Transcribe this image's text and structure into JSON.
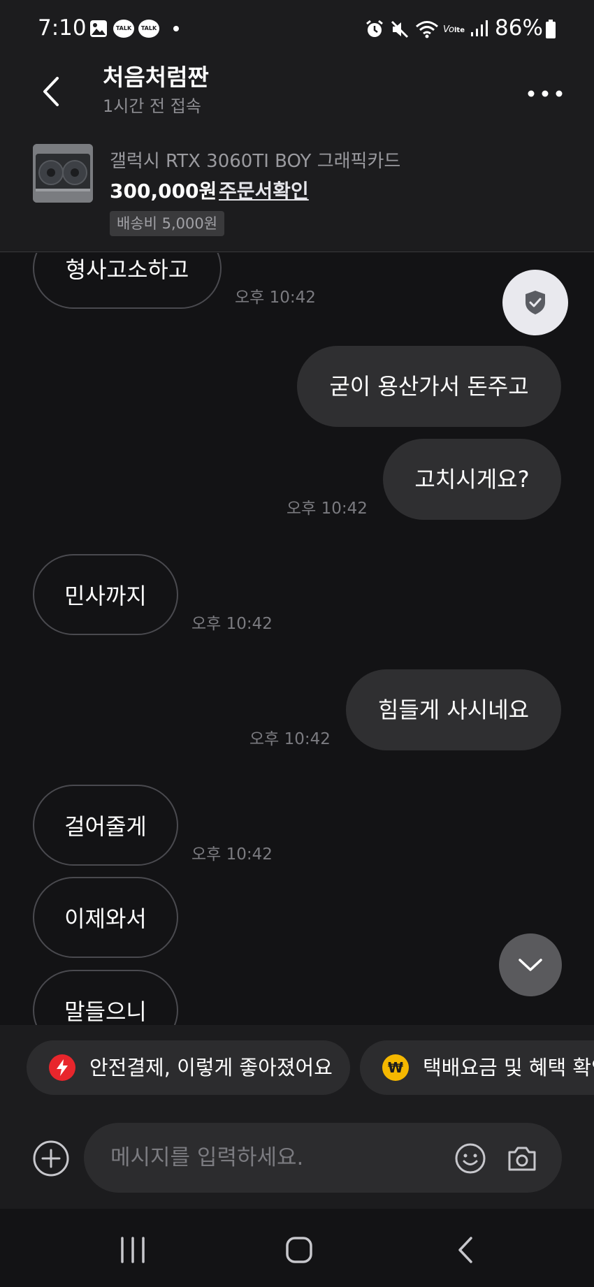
{
  "status_bar": {
    "time": "7:10",
    "battery": "86%",
    "talk_badge": "TALK"
  },
  "header": {
    "title": "처음처럼짠",
    "subtitle": "1시간 전 접속"
  },
  "product": {
    "name": "갤럭시 RTX 3060TI BOY 그래픽카드",
    "price": "300,000원",
    "order_link": "주문서확인",
    "shipping": "배송비 5,000원"
  },
  "messages": [
    {
      "side": "received",
      "text": "형사고소하고",
      "time": "오후 10:42"
    },
    {
      "side": "sent",
      "text": "굳이 용산가서 돈주고"
    },
    {
      "side": "sent",
      "text": "고치시게요?",
      "time": "오후 10:42"
    },
    {
      "side": "received",
      "text": "민사까지",
      "time": "오후 10:42"
    },
    {
      "side": "sent",
      "text": "힘들게 사시네요",
      "time": "오후 10:42"
    },
    {
      "side": "received",
      "text": "걸어줄게",
      "time": "오후 10:42"
    },
    {
      "side": "received",
      "text": "이제와서"
    },
    {
      "side": "received",
      "text": "말들으니"
    }
  ],
  "chips": [
    {
      "label": "안전결제, 이렇게 좋아졌어요",
      "icon": "lightning-icon",
      "color": "#e8262c"
    },
    {
      "label": "택배요금 및 혜택 확인",
      "icon": "won-coin-icon",
      "color": "#f5b800"
    }
  ],
  "input": {
    "placeholder": "메시지를 입력하세요."
  },
  "icons": {
    "back": "chevron-left-icon",
    "more": "more-dots-icon",
    "shield": "shield-check-icon",
    "scroll_down": "chevron-down-icon",
    "plus": "plus-circle-icon",
    "emoji": "smiley-icon",
    "camera": "camera-icon",
    "nav_recents": "recents-icon",
    "nav_home": "home-icon",
    "nav_back": "nav-back-icon"
  }
}
